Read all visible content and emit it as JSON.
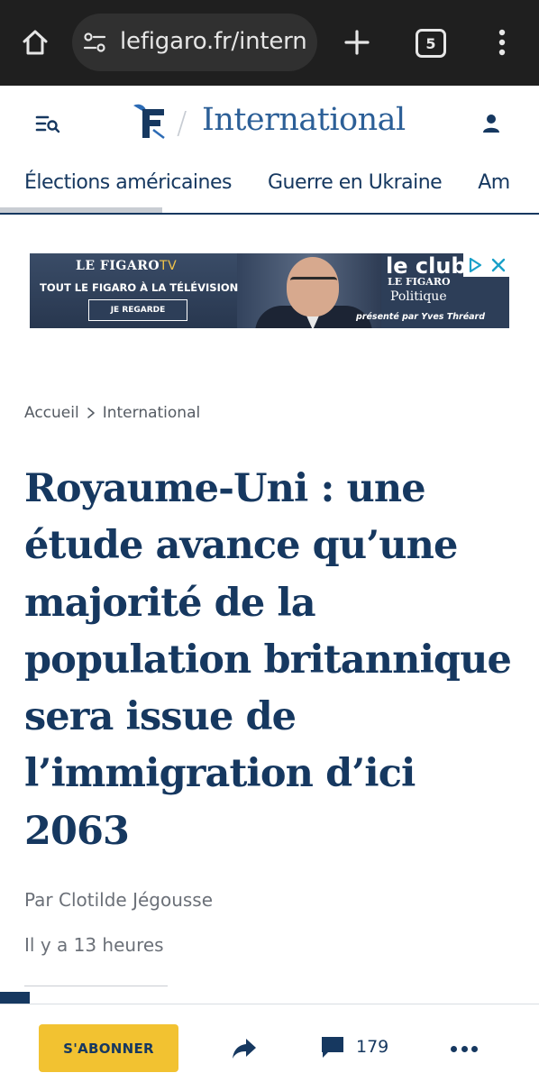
{
  "browser": {
    "url": "lefigaro.fr/intern",
    "tab_count": "5",
    "icons": [
      "home-icon",
      "site-settings-icon",
      "plus-icon",
      "tabs-icon",
      "more-vert-icon"
    ]
  },
  "header": {
    "section_title": "International",
    "icons": [
      "search-menu-icon",
      "le-figaro-logo",
      "account-icon"
    ]
  },
  "nav": {
    "items": [
      "Élections américaines",
      "Guerre en Ukraine",
      "Am"
    ]
  },
  "ad": {
    "brand": "LE FIGARO",
    "brand_tv": "TV",
    "tagline": "TOUT LE FIGARO À LA TÉLÉVISION",
    "cta": "JE REGARDE",
    "club_title": "le club",
    "club_brand": "LE FIGARO",
    "club_section": "Politique",
    "club_host": "présenté par Yves Thréard",
    "icons": [
      "adchoices-icon",
      "close-icon"
    ]
  },
  "article": {
    "breadcrumb": [
      "Accueil",
      "International"
    ],
    "headline": "Royaume-Uni : une étude avance qu’une majorité de la population britannique sera issue de l’immigration d’ici 2063",
    "byline": "Par Clotilde Jégousse",
    "timestamp": "Il y a 13 heures"
  },
  "actions": {
    "subscribe_label": "S'ABONNER",
    "comments_count": "179",
    "icons": [
      "share-icon",
      "comment-icon",
      "more-horiz-icon"
    ]
  },
  "colors": {
    "navy": "#163860",
    "section_blue": "#2c5f97",
    "subscribe_yellow": "#f2c231",
    "browser_dark": "#1f1f1f"
  }
}
